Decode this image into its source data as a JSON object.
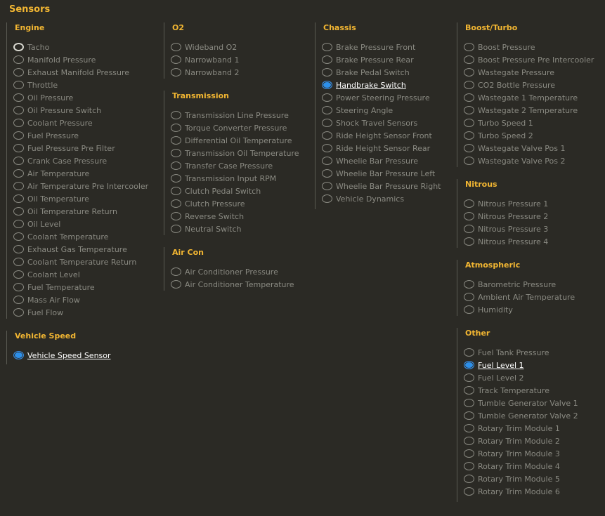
{
  "title": "Sensors",
  "groups": {
    "engine": {
      "title": "Engine",
      "items": [
        {
          "label": "Tacho"
        },
        {
          "label": "Manifold Pressure"
        },
        {
          "label": "Exhaust Manifold Pressure"
        },
        {
          "label": "Throttle"
        },
        {
          "label": "Oil Pressure"
        },
        {
          "label": "Oil Pressure Switch"
        },
        {
          "label": "Coolant Pressure"
        },
        {
          "label": "Fuel Pressure"
        },
        {
          "label": "Fuel Pressure Pre Filter"
        },
        {
          "label": "Crank Case Pressure"
        },
        {
          "label": "Air Temperature"
        },
        {
          "label": "Air Temperature Pre Intercooler"
        },
        {
          "label": "Oil Temperature"
        },
        {
          "label": "Oil Temperature Return"
        },
        {
          "label": "Oil Level"
        },
        {
          "label": "Coolant Temperature"
        },
        {
          "label": "Exhaust Gas Temperature"
        },
        {
          "label": "Coolant Temperature Return"
        },
        {
          "label": "Coolant Level"
        },
        {
          "label": "Fuel Temperature"
        },
        {
          "label": "Mass Air Flow"
        },
        {
          "label": "Fuel Flow"
        }
      ]
    },
    "vehicle_speed": {
      "title": "Vehicle Speed",
      "items": [
        {
          "label": "Vehicle Speed Sensor"
        }
      ]
    },
    "o2": {
      "title": "O2",
      "items": [
        {
          "label": "Wideband O2"
        },
        {
          "label": "Narrowband 1"
        },
        {
          "label": "Narrowband 2"
        }
      ]
    },
    "transmission": {
      "title": "Transmission",
      "items": [
        {
          "label": "Transmission Line Pressure"
        },
        {
          "label": "Torque Converter Pressure"
        },
        {
          "label": "Differential Oil Temperature"
        },
        {
          "label": "Transmission Oil Temperature"
        },
        {
          "label": "Transfer Case Pressure"
        },
        {
          "label": "Transmission Input RPM"
        },
        {
          "label": "Clutch Pedal Switch"
        },
        {
          "label": "Clutch Pressure"
        },
        {
          "label": "Reverse Switch"
        },
        {
          "label": "Neutral Switch"
        }
      ]
    },
    "air_con": {
      "title": "Air Con",
      "items": [
        {
          "label": "Air Conditioner Pressure"
        },
        {
          "label": "Air Conditioner Temperature"
        }
      ]
    },
    "chassis": {
      "title": "Chassis",
      "items": [
        {
          "label": "Brake Pressure Front"
        },
        {
          "label": "Brake Pressure Rear"
        },
        {
          "label": "Brake Pedal Switch"
        },
        {
          "label": "Handbrake Switch"
        },
        {
          "label": "Power Steering Pressure"
        },
        {
          "label": "Steering Angle"
        },
        {
          "label": "Shock Travel Sensors"
        },
        {
          "label": "Ride Height Sensor Front"
        },
        {
          "label": "Ride Height Sensor Rear"
        },
        {
          "label": "Wheelie Bar Pressure"
        },
        {
          "label": "Wheelie Bar Pressure Left"
        },
        {
          "label": "Wheelie Bar Pressure Right"
        },
        {
          "label": "Vehicle Dynamics"
        }
      ]
    },
    "boost_turbo": {
      "title": "Boost/Turbo",
      "items": [
        {
          "label": "Boost Pressure"
        },
        {
          "label": "Boost Pressure Pre Intercooler"
        },
        {
          "label": "Wastegate Pressure"
        },
        {
          "label": "CO2 Bottle Pressure"
        },
        {
          "label": "Wastegate 1 Temperature"
        },
        {
          "label": "Wastegate 2 Temperature"
        },
        {
          "label": "Turbo Speed 1"
        },
        {
          "label": "Turbo Speed 2"
        },
        {
          "label": "Wastegate Valve Pos 1"
        },
        {
          "label": "Wastegate Valve Pos 2"
        }
      ]
    },
    "nitrous": {
      "title": "Nitrous",
      "items": [
        {
          "label": "Nitrous Pressure 1"
        },
        {
          "label": "Nitrous Pressure 2"
        },
        {
          "label": "Nitrous Pressure 3"
        },
        {
          "label": "Nitrous Pressure 4"
        }
      ]
    },
    "atmospheric": {
      "title": "Atmospheric",
      "items": [
        {
          "label": "Barometric Pressure"
        },
        {
          "label": "Ambient Air Temperature"
        },
        {
          "label": "Humidity"
        }
      ]
    },
    "other": {
      "title": "Other",
      "items": [
        {
          "label": "Fuel Tank Pressure"
        },
        {
          "label": "Fuel Level 1"
        },
        {
          "label": "Fuel Level 2"
        },
        {
          "label": "Track Temperature"
        },
        {
          "label": "Tumble Generator Valve 1"
        },
        {
          "label": "Tumble Generator Valve 2"
        },
        {
          "label": "Rotary Trim Module 1"
        },
        {
          "label": "Rotary Trim Module 2"
        },
        {
          "label": "Rotary Trim Module 3"
        },
        {
          "label": "Rotary Trim Module 4"
        },
        {
          "label": "Rotary Trim Module 5"
        },
        {
          "label": "Rotary Trim Module 6"
        }
      ]
    }
  },
  "selected": [
    "Vehicle Speed Sensor",
    "Handbrake Switch",
    "Fuel Level 1"
  ],
  "focused": "Tacho",
  "colors": {
    "background": "#2b2a25",
    "heading": "#f2b632",
    "text": "#8a8a82",
    "selected_text": "#ffffff",
    "radio_selected": "#2d8fe9"
  }
}
